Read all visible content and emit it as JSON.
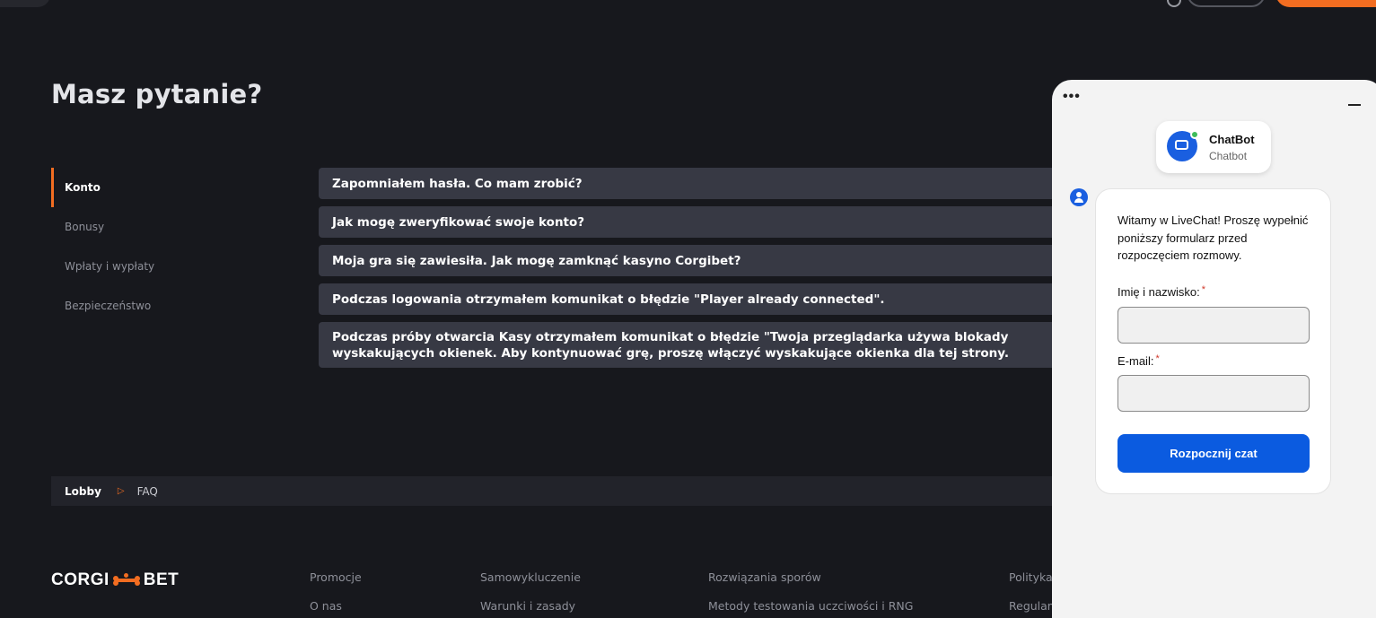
{
  "page": {
    "title": "Masz pytanie?"
  },
  "categories": [
    {
      "label": "Konto",
      "active": true
    },
    {
      "label": "Bonusy"
    },
    {
      "label": "Wpłaty i wypłaty"
    },
    {
      "label": "Bezpieczeństwo"
    }
  ],
  "faq": [
    "Zapomniałem hasła. Co mam zrobić?",
    "Jak mogę zweryfikować swoje konto?",
    "Moja gra się zawiesiła. Jak mogę zamknąć kasyno Corgibet?",
    "Podczas logowania otrzymałem komunikat o błędzie \"Player already connected\".",
    "Podczas próby otwarcia Kasy otrzymałem komunikat o błędzie \"Twoja przeglądarka używa blokady wyskakujących okienek. Aby kontynuować grę, proszę włączyć wyskakujące okienka dla tej strony."
  ],
  "breadcrumb": {
    "lobby": "Lobby",
    "separator": "▷",
    "current": "FAQ"
  },
  "footer": {
    "logo": {
      "left": "CORGI",
      "right": "BET"
    },
    "links": [
      "Promocje",
      "O nas",
      "Samowykluczenie",
      "Warunki i zasady",
      "Rozwiązania sporów",
      "Metody testowania uczciwości i RNG",
      "Polityka",
      "Regulamin"
    ]
  },
  "chat": {
    "menu_glyph": "•••",
    "bot_name": "ChatBot",
    "bot_sub": "Chatbot",
    "welcome": "Witamy w LiveChat! Proszę wypełnić poniższy formularz przed rozpoczęciem rozmowy.",
    "name_label": "Imię i nazwisko:",
    "email_label": "E-mail:",
    "required_mark": "*",
    "name_value": "",
    "email_value": "",
    "start_button": "Rozpocznij czat"
  },
  "colors": {
    "accent": "#f26d21",
    "chat_primary": "#0b5be0",
    "background": "#17181d",
    "faq_item": "#373944"
  },
  "icons": [
    "search-icon",
    "bone-icon",
    "chatbot-icon",
    "online-dot-icon",
    "user-icon",
    "minimize-icon",
    "more-icon",
    "chevron-right-icon"
  ]
}
